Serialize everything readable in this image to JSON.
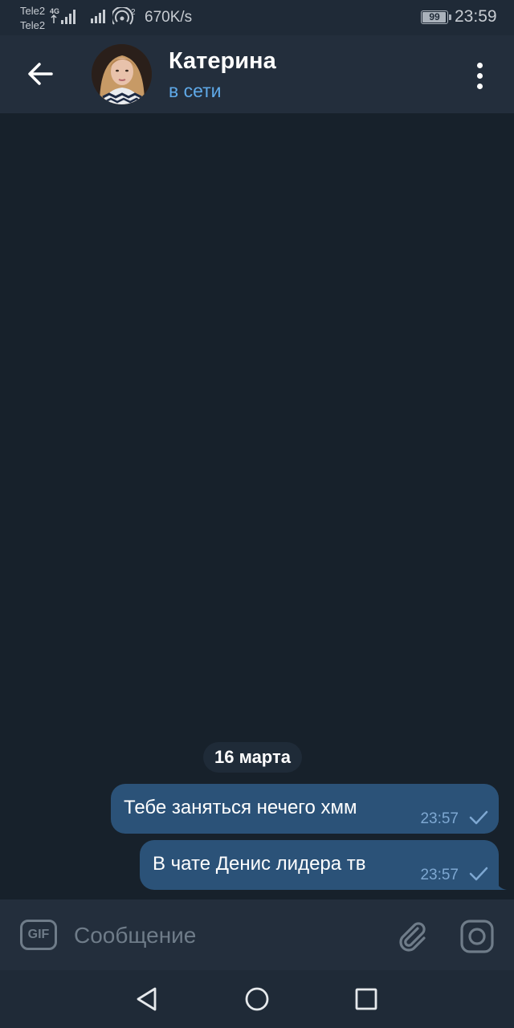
{
  "status_bar": {
    "carrier1": "Tele2",
    "carrier2": "Tele2",
    "network_type": "4G",
    "hotspot_badge": "2",
    "speed": "670K/s",
    "battery": "99",
    "time": "23:59"
  },
  "header": {
    "contact_name": "Катерина",
    "contact_status": "в сети",
    "back_icon": "arrow-left-icon",
    "menu_icon": "more-vertical-icon"
  },
  "chat": {
    "date_separator": "16 марта",
    "messages": [
      {
        "text": "Тебе заняться нечего хмм",
        "time": "23:57",
        "status": "sent"
      },
      {
        "text": "В чате Денис лидера тв",
        "time": "23:57",
        "status": "sent"
      }
    ]
  },
  "input_bar": {
    "gif_label": "GIF",
    "placeholder": "Сообщение",
    "value": ""
  },
  "nav_bar": {
    "icons": [
      "nav-back-icon",
      "nav-home-icon",
      "nav-recents-icon"
    ]
  },
  "colors": {
    "background": "#17212b",
    "header": "#232e3c",
    "bubble_out": "#2b5278",
    "accent": "#5fa9e8"
  }
}
